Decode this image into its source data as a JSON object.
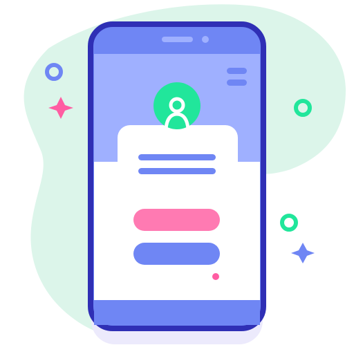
{
  "illustration": {
    "subject": "smartphone-login-screen",
    "colors": {
      "blob": "#dcf5ea",
      "phone_outline": "#2f2fb5",
      "phone_body": "#6f86f4",
      "screen_header": "#9fb0ff",
      "screen_body": "#ffffff",
      "text_line": "#6f86f4",
      "primary_pill": "#ff7ab2",
      "secondary_pill": "#6f86f4",
      "avatar": "#21e69b",
      "accent_pink": "#ff5da2",
      "accent_blue": "#6f86f4",
      "accent_green": "#21e69b",
      "shadow": "#eceafc"
    },
    "icons": {
      "menu": "hamburger-menu-icon",
      "avatar": "user-avatar-icon",
      "sparkle_left": "sparkle-icon",
      "sparkle_right": "sparkle-icon"
    }
  }
}
